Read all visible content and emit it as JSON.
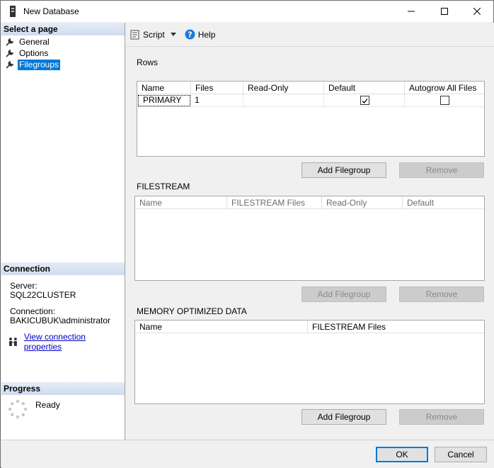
{
  "window": {
    "title": "New Database"
  },
  "left": {
    "select_page_header": "Select a page",
    "pages": [
      {
        "label": "General",
        "selected": false
      },
      {
        "label": "Options",
        "selected": false
      },
      {
        "label": "Filegroups",
        "selected": true
      }
    ],
    "connection_header": "Connection",
    "server_label": "Server:",
    "server_value": "SQL22CLUSTER",
    "connection_label": "Connection:",
    "connection_value": "BAKICUBUK\\administrator",
    "view_props_link": "View connection properties",
    "progress_header": "Progress",
    "progress_status": "Ready"
  },
  "toolbar": {
    "script_label": "Script",
    "help_label": "Help"
  },
  "rows_section": {
    "label": "Rows",
    "columns": [
      "Name",
      "Files",
      "Read-Only",
      "Default",
      "Autogrow All Files"
    ],
    "rows": [
      {
        "name": "PRIMARY",
        "files": "1",
        "read_only": "",
        "default": true,
        "autogrow": false
      }
    ],
    "add_button": "Add Filegroup",
    "remove_button": "Remove"
  },
  "filestream_section": {
    "label": "FILESTREAM",
    "columns": [
      "Name",
      "FILESTREAM Files",
      "Read-Only",
      "Default"
    ],
    "add_button": "Add Filegroup",
    "remove_button": "Remove"
  },
  "memory_section": {
    "label": "MEMORY OPTIMIZED DATA",
    "columns": [
      "Name",
      "FILESTREAM Files"
    ],
    "add_button": "Add Filegroup",
    "remove_button": "Remove"
  },
  "footer": {
    "ok_button": "OK",
    "cancel_button": "Cancel"
  },
  "colors": {
    "accent": "#0078d7",
    "link": "#0000cc",
    "header_grad_top": "#e4ecf7"
  }
}
